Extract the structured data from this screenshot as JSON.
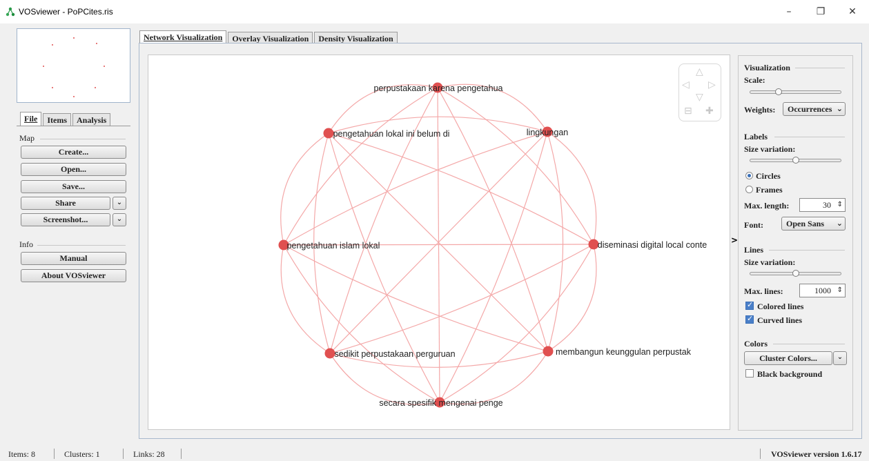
{
  "window": {
    "title": "VOSviewer - PoPCites.ris",
    "minimize": "–",
    "restore": "❐",
    "close": "✕"
  },
  "main_tabs": [
    {
      "label": "Network Visualization",
      "active": true
    },
    {
      "label": "Overlay Visualization",
      "active": false
    },
    {
      "label": "Density Visualization",
      "active": false
    }
  ],
  "left_tabs": [
    {
      "label": "File",
      "active": true
    },
    {
      "label": "Items",
      "active": false
    },
    {
      "label": "Analysis",
      "active": false
    }
  ],
  "left_panel": {
    "map_label": "Map",
    "create": "Create...",
    "open": "Open...",
    "save": "Save...",
    "share": "Share",
    "screenshot": "Screenshot...",
    "info_label": "Info",
    "manual": "Manual",
    "about": "About VOSviewer"
  },
  "right_panel": {
    "visualization_label": "Visualization",
    "scale_label": "Scale:",
    "scale_value": 0.3,
    "weights_label": "Weights:",
    "weights_value": "Occurrences",
    "labels_label": "Labels",
    "size_variation_label": "Size variation:",
    "label_size_variation": 0.5,
    "circles": "Circles",
    "frames": "Frames",
    "max_length_label": "Max. length:",
    "max_length_value": "30",
    "font_label": "Font:",
    "font_value": "Open Sans",
    "lines_label": "Lines",
    "lines_size_variation_label": "Size variation:",
    "lines_size_variation": 0.5,
    "max_lines_label": "Max. lines:",
    "max_lines_value": "1000",
    "colored_lines": "Colored lines",
    "curved_lines": "Curved lines",
    "colors_label": "Colors",
    "cluster_colors": "Cluster Colors...",
    "black_background": "Black background",
    "collapse": ">"
  },
  "network": {
    "node_color": "#e05050",
    "edge_color": "#f4a8a8",
    "nodes": [
      "perpustakaan karena pengetahua",
      "lingkungan",
      "diseminasi digital local conte",
      "membangun keunggulan perpustak",
      "secara spesifik mengenai penge",
      "sedikit perpustakaan perguruan",
      "pengetahuan islam lokal",
      "pengetahuan lokal ini belum di"
    ]
  },
  "status": {
    "items": "Items:  8",
    "clusters": "Clusters:  1",
    "links": "Links:  28",
    "version": "VOSviewer version 1.6.17"
  }
}
